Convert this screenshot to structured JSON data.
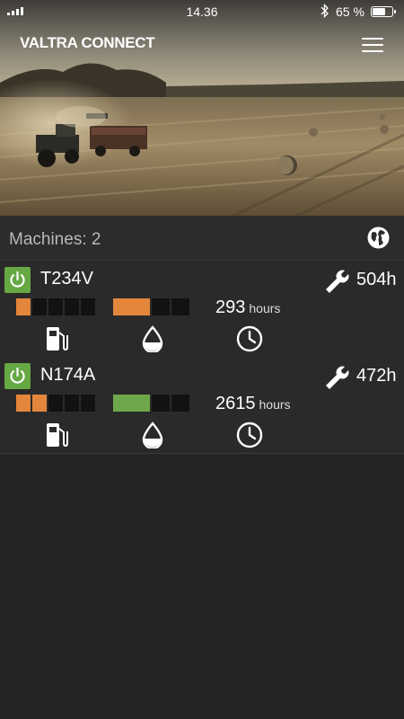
{
  "status_bar": {
    "time": "14.36",
    "battery": "65 %",
    "battery_level": 0.65
  },
  "app": {
    "logo": "VALTRA CONNECT"
  },
  "machines_header": {
    "label": "Machines: 2"
  },
  "machines": [
    {
      "name": "T234V",
      "status": "on",
      "service_hours": "504h",
      "fuel_segments_filled": 1,
      "fuel_segments_total": 5,
      "level_color": "#e3863b",
      "engine_hours_value": "293",
      "engine_hours_unit": "hours"
    },
    {
      "name": "N174A",
      "status": "on",
      "service_hours": "472h",
      "fuel_segments_filled": 2,
      "fuel_segments_total": 5,
      "level_color": "#6fa84a",
      "engine_hours_value": "2615",
      "engine_hours_unit": "hours"
    }
  ],
  "icons": {
    "menu": "hamburger-menu-icon",
    "globe": "globe-icon",
    "power": "power-icon",
    "wrench": "wrench-icon",
    "fuel": "fuel-pump-icon",
    "fluid": "drop-icon",
    "clock": "clock-icon"
  },
  "colors": {
    "accent_orange": "#e3863b",
    "status_green": "#66a843",
    "background": "#242424"
  }
}
